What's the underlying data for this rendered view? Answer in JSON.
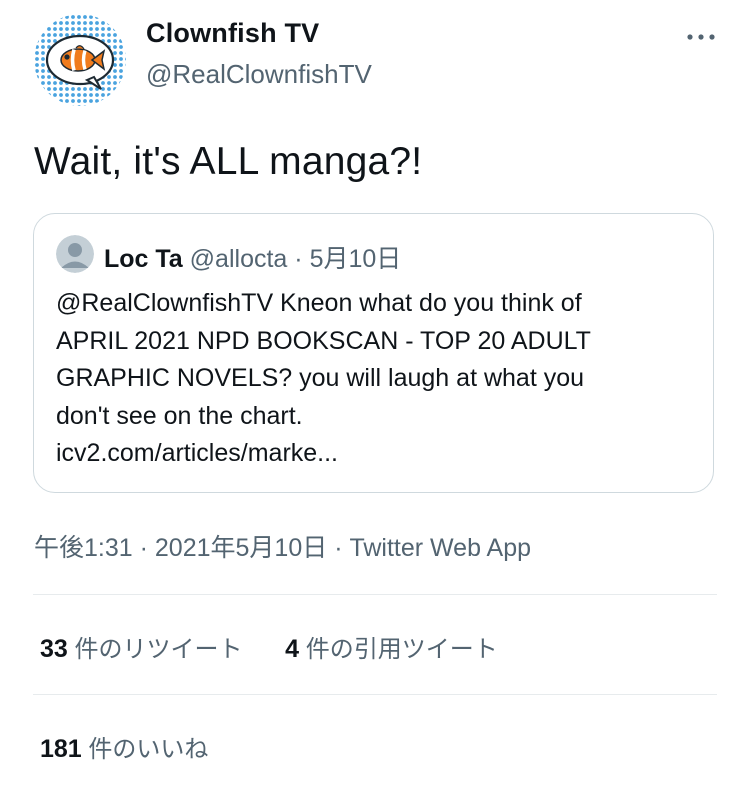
{
  "author": {
    "display_name": "Clownfish TV",
    "handle": "@RealClownfishTV",
    "avatar_icon": "clownfish-logo"
  },
  "tweet": {
    "text": "Wait, it's ALL manga?!"
  },
  "quoted_tweet": {
    "name": "Loc Ta",
    "handle": "@allocta",
    "separator": "·",
    "date": "5月10日",
    "lines": [
      "@RealClownfishTV Kneon what do you think of",
      "APRIL 2021 NPD BOOKSCAN - TOP 20 ADULT",
      "GRAPHIC NOVELS? you will laugh at what you",
      "don't see on the chart.",
      "icv2.com/articles/marke..."
    ]
  },
  "meta": {
    "time": "午後1:31",
    "separator": "·",
    "date": "2021年5月10日",
    "source": "Twitter Web App"
  },
  "stats": {
    "retweets_count": "33",
    "retweets_label": "件のリツイート",
    "quotes_count": "4",
    "quotes_label": "件の引用ツイート",
    "likes_count": "181",
    "likes_label": "件のいいね"
  },
  "colors": {
    "text_primary": "#0f1419",
    "text_secondary": "#536471",
    "border": "#cfd9de",
    "avatar_dots": "#4aa3df",
    "fish_orange": "#f07c1e"
  }
}
